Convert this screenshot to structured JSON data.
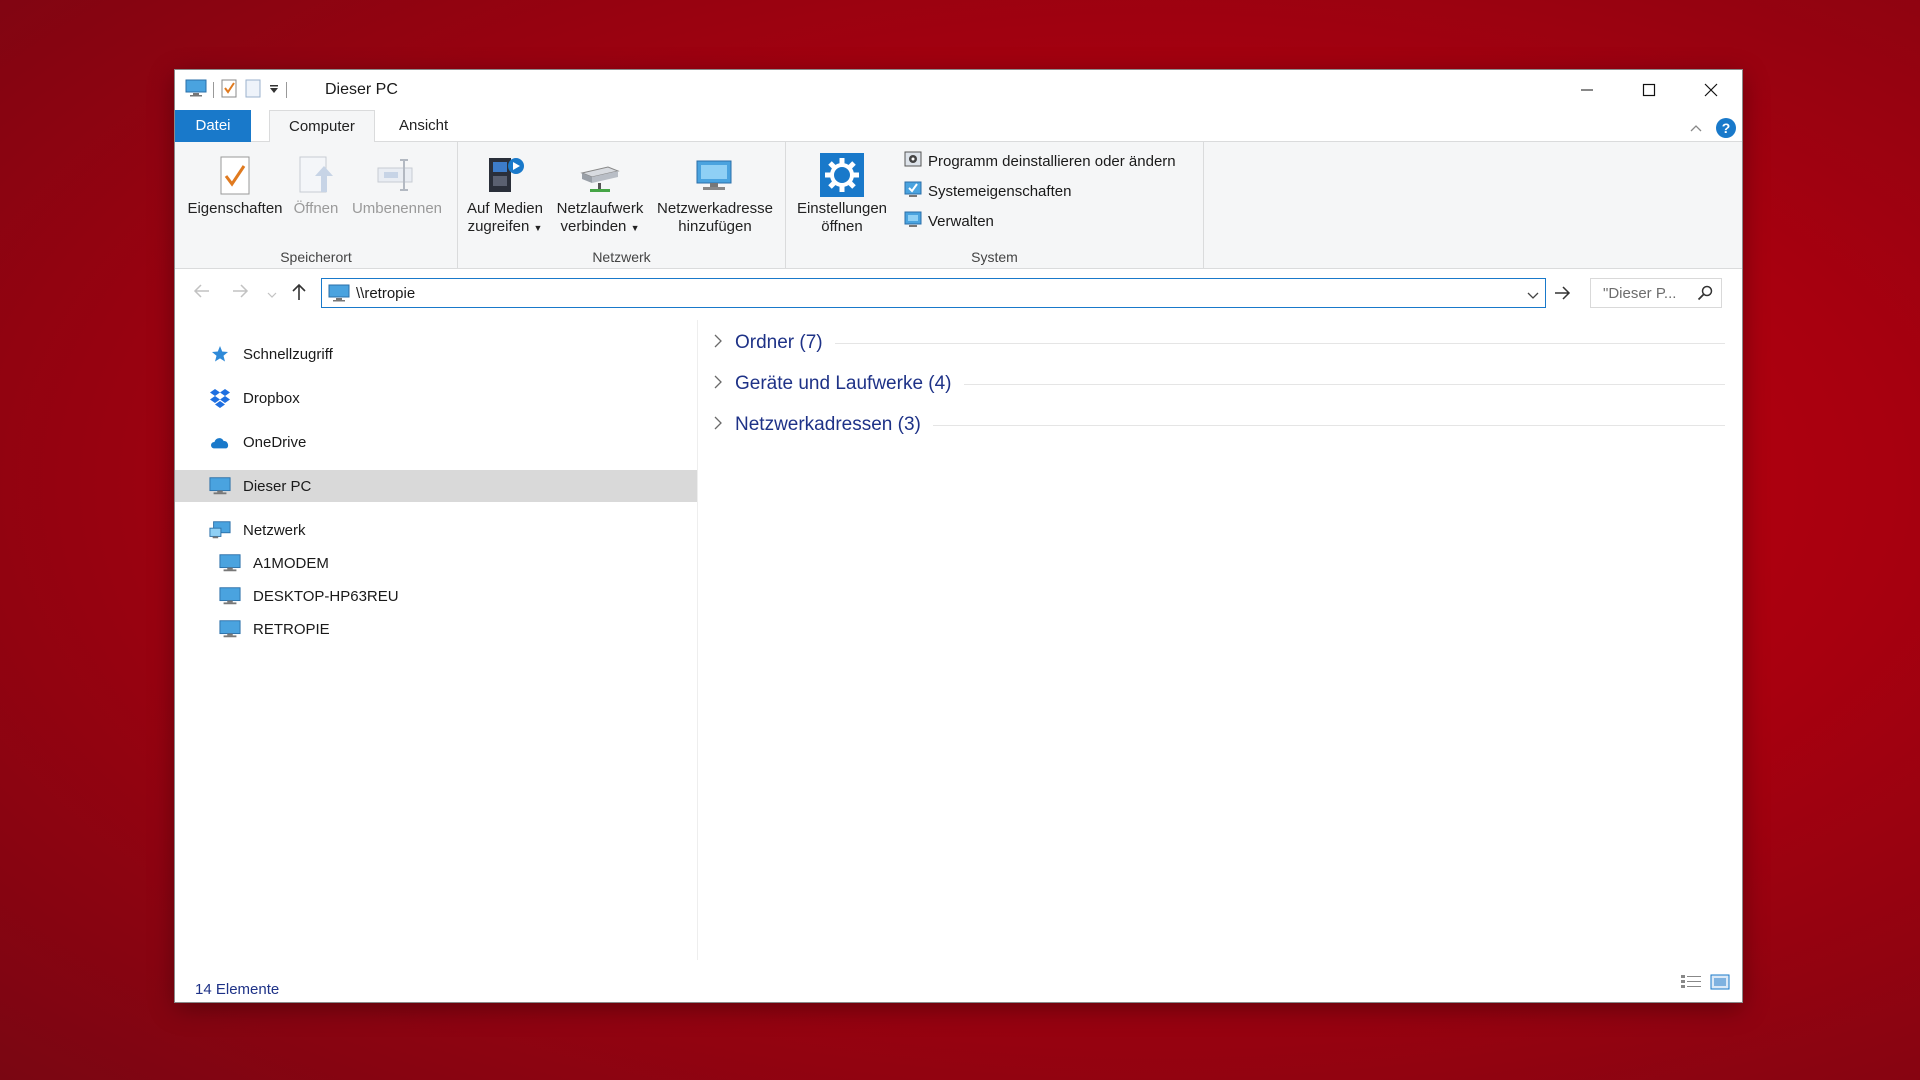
{
  "window": {
    "title": "Dieser PC"
  },
  "tabs": [
    {
      "label": "Datei"
    },
    {
      "label": "Computer"
    },
    {
      "label": "Ansicht"
    }
  ],
  "help_label": "?",
  "ribbon": {
    "groups": {
      "speicherort": {
        "label": "Speicherort",
        "buttons": [
          {
            "label": "Eigenschaften",
            "icon": "properties-checklist-icon"
          },
          {
            "label": "Öffnen",
            "icon": "open-icon",
            "disabled": true
          },
          {
            "label": "Umbenennen",
            "icon": "rename-icon",
            "disabled": true
          }
        ]
      },
      "netzwerk": {
        "label": "Netzwerk",
        "buttons": [
          {
            "line1": "Auf Medien",
            "line2": "zugreifen",
            "dropdown": true,
            "icon": "media-access-icon"
          },
          {
            "line1": "Netzlaufwerk",
            "line2": "verbinden",
            "dropdown": true,
            "icon": "network-drive-icon"
          },
          {
            "line1": "Netzwerkadresse",
            "line2": "hinzufügen",
            "icon": "network-location-icon"
          }
        ]
      },
      "system": {
        "label": "System",
        "settings_line1": "Einstellungen",
        "settings_line2": "öffnen",
        "items": [
          {
            "label": "Programm deinstallieren oder ändern",
            "icon": "uninstall-program-icon"
          },
          {
            "label": "Systemeigenschaften",
            "icon": "system-properties-icon"
          },
          {
            "label": "Verwalten",
            "icon": "manage-icon"
          }
        ]
      }
    }
  },
  "address": {
    "path": "\\\\retropie"
  },
  "search": {
    "placeholder": "\"Dieser P..."
  },
  "navpane": {
    "items": [
      {
        "label": "Schnellzugriff",
        "icon": "star-icon"
      },
      {
        "label": "Dropbox",
        "icon": "dropbox-icon"
      },
      {
        "label": "OneDrive",
        "icon": "cloud-icon"
      },
      {
        "label": "Dieser PC",
        "icon": "pc-icon",
        "selected": true
      },
      {
        "label": "Netzwerk",
        "icon": "network-icon"
      },
      {
        "label": "A1MODEM",
        "icon": "computer-icon"
      },
      {
        "label": "DESKTOP-HP63REU",
        "icon": "computer-icon"
      },
      {
        "label": "RETROPIE",
        "icon": "computer-icon"
      }
    ]
  },
  "content": {
    "groups": [
      {
        "label": "Ordner (7)"
      },
      {
        "label": "Geräte und Laufwerke (4)"
      },
      {
        "label": "Netzwerkadressen (3)"
      }
    ]
  },
  "status": {
    "count": "14 Elemente"
  },
  "colors": {
    "accent": "#1979ca",
    "group_title": "#1e3287",
    "background": "#b0000f"
  }
}
